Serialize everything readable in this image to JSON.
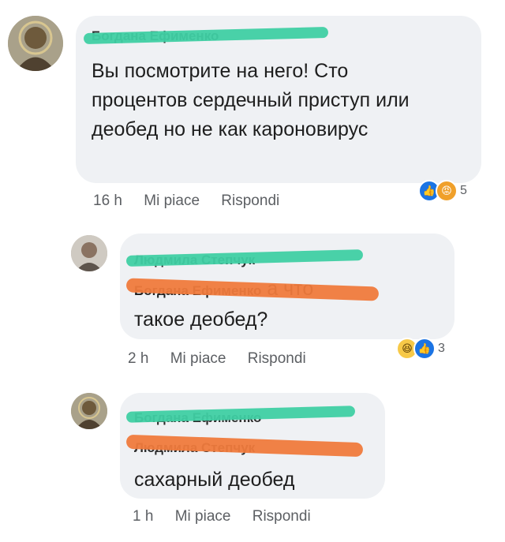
{
  "comments": [
    {
      "author": "Богдана Ефименко",
      "text": "Вы посмотрите на него! Сто процентов сердечный приступ или деобед но не как кароновирус",
      "time": "16 h",
      "like_label": "Mi piace",
      "reply_label": "Rispondi",
      "reactions": [
        "like",
        "angry"
      ],
      "reaction_count": "5"
    },
    {
      "author": "Людмила Степчук",
      "mention": "Богдана Ефименко",
      "text_after_mention": "а что",
      "text": "такое деобед?",
      "time": "2 h",
      "like_label": "Mi piace",
      "reply_label": "Rispondi",
      "reactions": [
        "haha",
        "like"
      ],
      "reaction_count": "3"
    },
    {
      "author": "Богдана Ефименко",
      "mention": "Людмила Степчук",
      "text": "сахарный деобед",
      "time": "1 h",
      "like_label": "Mi piace",
      "reply_label": "Rispondi"
    }
  ],
  "colors": {
    "bubble": "#eff1f4",
    "redaction_green": "#3fcfa3",
    "redaction_orange": "#ef7a3c",
    "like": "#1b74e4"
  }
}
